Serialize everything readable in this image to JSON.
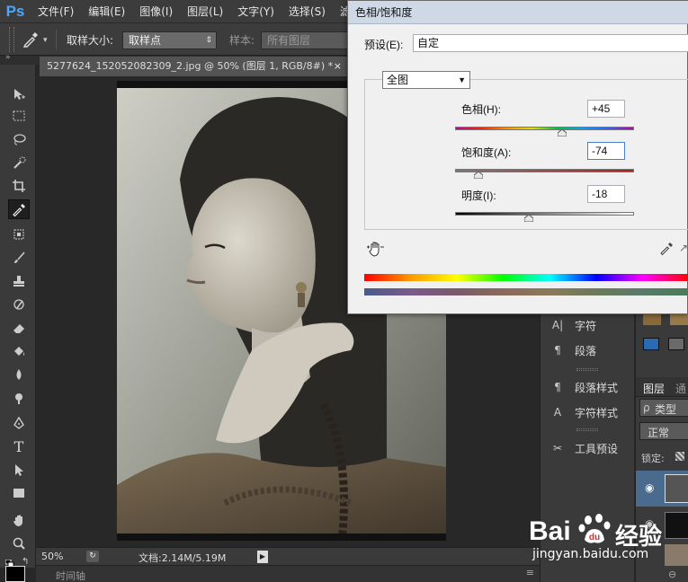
{
  "menubar": {
    "logo": "Ps",
    "items": [
      "文件(F)",
      "编辑(E)",
      "图像(I)",
      "图层(L)",
      "文字(Y)",
      "选择(S)",
      "滤"
    ]
  },
  "options": {
    "sample_size_label": "取样大小:",
    "sample_size_value": "取样点",
    "sample_label": "样本:",
    "sample_value": "所有图层"
  },
  "document": {
    "tab_title": "5277624_152052082309_2.jpg @ 50% (图层 1, RGB/8#) *",
    "close": "×"
  },
  "status": {
    "zoom": "50%",
    "doc_info": "文档:2.14M/5.19M",
    "timeline_label": "时间轴"
  },
  "dialog": {
    "title": "色相/饱和度",
    "preset_label": "预设(E):",
    "preset_value": "自定",
    "channel_value": "全图",
    "hue_label": "色相(H):",
    "hue_value": "+45",
    "hue_fraction": 0.6,
    "saturation_label": "饱和度(A):",
    "saturation_value": "-74",
    "saturation_fraction": 0.13,
    "lightness_label": "明度(I):",
    "lightness_value": "-18",
    "lightness_fraction": 0.41
  },
  "panels": {
    "char_label": "字符",
    "para_label": "段落",
    "para_style_label": "段落样式",
    "char_style_label": "字符样式",
    "tool_preset_label": "工具预设",
    "layers_tab": "图层",
    "channels_tab": "通",
    "kind_label": "类型",
    "blend_mode": "正常",
    "lock_label": "锁定:"
  },
  "watermark": {
    "brand_a": "Bai",
    "brand_b": "经验",
    "url": "jingyan.baidu.com"
  },
  "colors": {
    "accent": "#4aa8ff",
    "dialog_bg": "#f0f0f0",
    "titlebar": "#cfd9e6"
  }
}
